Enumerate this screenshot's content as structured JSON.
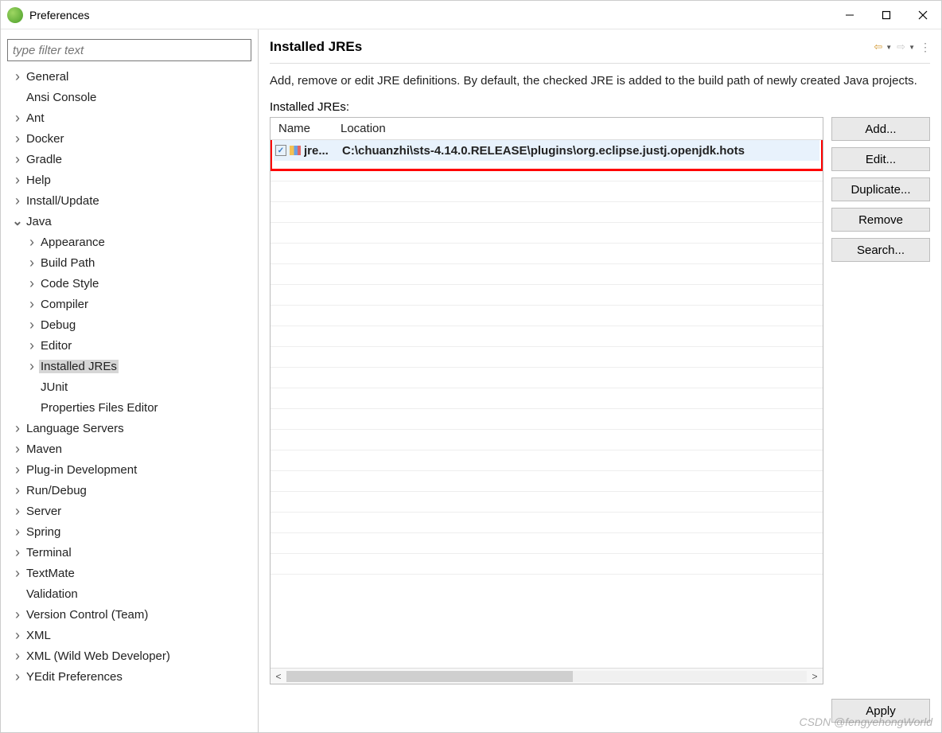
{
  "window": {
    "title": "Preferences"
  },
  "filter": {
    "placeholder": "type filter text"
  },
  "tree": [
    {
      "label": "General",
      "expandable": true,
      "expanded": false,
      "indent": 0
    },
    {
      "label": "Ansi Console",
      "expandable": false,
      "indent": 0
    },
    {
      "label": "Ant",
      "expandable": true,
      "expanded": false,
      "indent": 0
    },
    {
      "label": "Docker",
      "expandable": true,
      "expanded": false,
      "indent": 0
    },
    {
      "label": "Gradle",
      "expandable": true,
      "expanded": false,
      "indent": 0
    },
    {
      "label": "Help",
      "expandable": true,
      "expanded": false,
      "indent": 0
    },
    {
      "label": "Install/Update",
      "expandable": true,
      "expanded": false,
      "indent": 0
    },
    {
      "label": "Java",
      "expandable": true,
      "expanded": true,
      "indent": 0
    },
    {
      "label": "Appearance",
      "expandable": true,
      "expanded": false,
      "indent": 1
    },
    {
      "label": "Build Path",
      "expandable": true,
      "expanded": false,
      "indent": 1
    },
    {
      "label": "Code Style",
      "expandable": true,
      "expanded": false,
      "indent": 1
    },
    {
      "label": "Compiler",
      "expandable": true,
      "expanded": false,
      "indent": 1
    },
    {
      "label": "Debug",
      "expandable": true,
      "expanded": false,
      "indent": 1
    },
    {
      "label": "Editor",
      "expandable": true,
      "expanded": false,
      "indent": 1
    },
    {
      "label": "Installed JREs",
      "expandable": true,
      "expanded": false,
      "indent": 1,
      "selected": true
    },
    {
      "label": "JUnit",
      "expandable": false,
      "indent": 1
    },
    {
      "label": "Properties Files Editor",
      "expandable": false,
      "indent": 1
    },
    {
      "label": "Language Servers",
      "expandable": true,
      "expanded": false,
      "indent": 0
    },
    {
      "label": "Maven",
      "expandable": true,
      "expanded": false,
      "indent": 0
    },
    {
      "label": "Plug-in Development",
      "expandable": true,
      "expanded": false,
      "indent": 0
    },
    {
      "label": "Run/Debug",
      "expandable": true,
      "expanded": false,
      "indent": 0
    },
    {
      "label": "Server",
      "expandable": true,
      "expanded": false,
      "indent": 0
    },
    {
      "label": "Spring",
      "expandable": true,
      "expanded": false,
      "indent": 0
    },
    {
      "label": "Terminal",
      "expandable": true,
      "expanded": false,
      "indent": 0
    },
    {
      "label": "TextMate",
      "expandable": true,
      "expanded": false,
      "indent": 0
    },
    {
      "label": "Validation",
      "expandable": false,
      "indent": 0
    },
    {
      "label": "Version Control (Team)",
      "expandable": true,
      "expanded": false,
      "indent": 0
    },
    {
      "label": "XML",
      "expandable": true,
      "expanded": false,
      "indent": 0
    },
    {
      "label": "XML (Wild Web Developer)",
      "expandable": true,
      "expanded": false,
      "indent": 0
    },
    {
      "label": "YEdit Preferences",
      "expandable": true,
      "expanded": false,
      "indent": 0
    }
  ],
  "page": {
    "title": "Installed JREs",
    "description": "Add, remove or edit JRE definitions. By default, the checked JRE is added to the build path of newly created Java projects.",
    "list_label": "Installed JREs:",
    "columns": {
      "name": "Name",
      "location": "Location"
    },
    "rows": [
      {
        "checked": true,
        "name": "jre...",
        "location": "C:\\chuanzhi\\sts-4.14.0.RELEASE\\plugins\\org.eclipse.justj.openjdk.hots"
      }
    ],
    "buttons": {
      "add": "Add...",
      "edit": "Edit...",
      "duplicate": "Duplicate...",
      "remove": "Remove",
      "search": "Search..."
    },
    "apply": "Apply"
  },
  "watermark": "CSDN @fengyehongWorld"
}
